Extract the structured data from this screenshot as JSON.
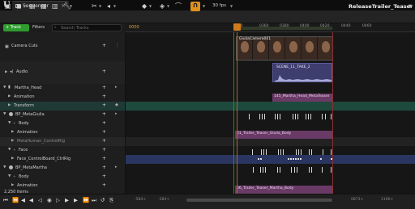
{
  "window": {
    "tab_title": "Sequencer",
    "sequence_name": "ReleaseTrailer_Teaser"
  },
  "toolbar": {
    "fps": "30 fps",
    "icons": [
      "save-icon",
      "camera-icon",
      "film-icon",
      "wrench-icon",
      "play-range-icon",
      "key-icon",
      "tag-icon",
      "magnet-icon"
    ]
  },
  "track_bar": {
    "add_track": "+ Track",
    "filters": "Filters",
    "search_placeholder": "Search Tracks",
    "current_time": "0000"
  },
  "ruler": {
    "ticks": [
      "0340",
      "0360",
      "0380",
      "0400",
      "0420",
      "0440",
      "0460"
    ]
  },
  "tracks": [
    {
      "label": "Camera Cuts"
    },
    {
      "label": "Audio"
    },
    {
      "label": "Martha_Head"
    },
    {
      "label": "Animation"
    },
    {
      "label": "Transform"
    },
    {
      "label": "BP_MetaGiulia"
    },
    {
      "label": "Body"
    },
    {
      "label": "Animation"
    },
    {
      "label": "MetaHuman_ControlRig"
    },
    {
      "label": "Face"
    },
    {
      "label": "Face_ControlBoard_CtrlRig"
    },
    {
      "label": "BP_MetaMartha"
    },
    {
      "label": "Body"
    },
    {
      "label": "Animation"
    }
  ],
  "clips": {
    "camera": "GiuliaCamera001",
    "audio": "SCENE_11_TAKE_2",
    "martha_head": "145_Martha_Head_MetaTeaser",
    "giulia_body": "01_Trailer_Teaser_Giulia_Body",
    "martha_body": "06_Trailer_Teaser_Martha_Body"
  },
  "bottom": {
    "items": "2,250 items",
    "left_time_a": "-584+",
    "left_time_b": "-584+",
    "right_time_a": "0873+",
    "right_time_b": "1166+"
  },
  "colors": {
    "accent": "#e0901e",
    "add_track": "#2e9c2e",
    "playhead": "#d07a1a"
  }
}
